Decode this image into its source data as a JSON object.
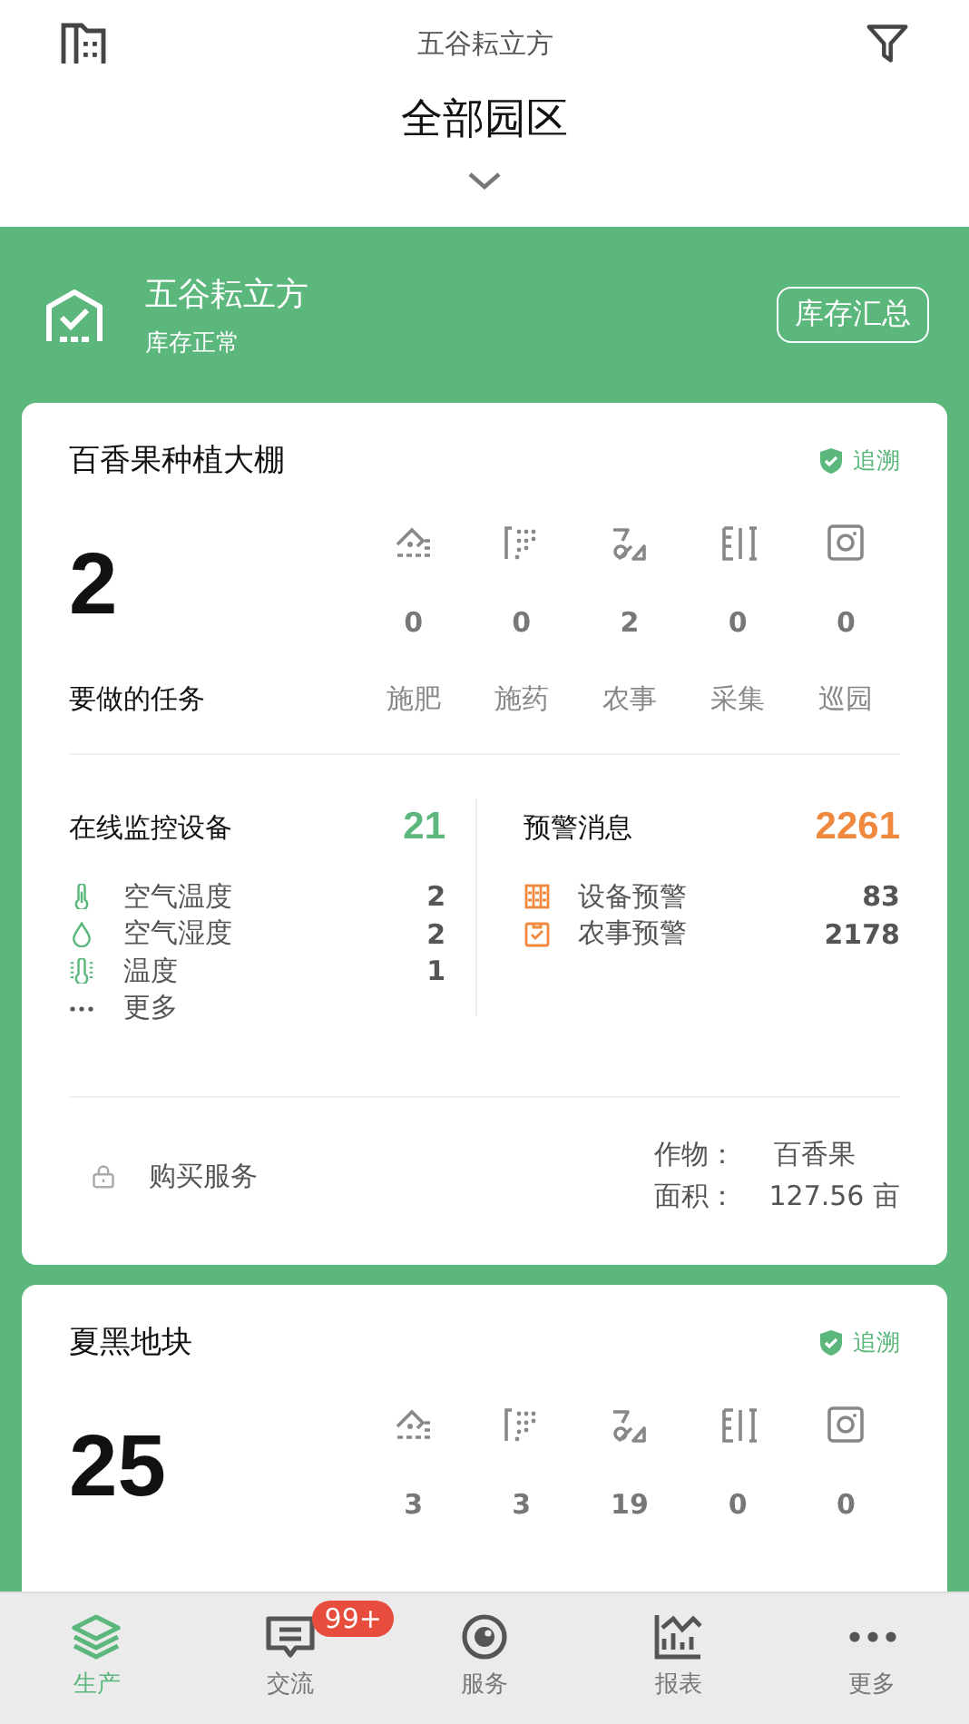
{
  "header": {
    "org": "五谷耘立方",
    "title": "全部园区"
  },
  "farm": {
    "name": "五谷耘立方",
    "status": "库存正常",
    "button": "库存汇总"
  },
  "cards": [
    {
      "title": "百香果种植大棚",
      "trace": "追溯",
      "tasks": {
        "count": "2",
        "label": "要做的任务"
      },
      "task_types": [
        {
          "kind": "fertilize",
          "count": "0",
          "label": "施肥"
        },
        {
          "kind": "spray",
          "count": "0",
          "label": "施药"
        },
        {
          "kind": "farm",
          "count": "2",
          "label": "农事"
        },
        {
          "kind": "harvest",
          "count": "0",
          "label": "采集"
        },
        {
          "kind": "patrol",
          "count": "0",
          "label": "巡园"
        }
      ],
      "monitoring": {
        "title": "在线监控设备",
        "count": "21",
        "items": [
          {
            "kind": "thermometer",
            "label": "空气温度",
            "count": "2"
          },
          {
            "kind": "drop",
            "label": "空气湿度",
            "count": "2"
          },
          {
            "kind": "heat",
            "label": "温度",
            "count": "1"
          },
          {
            "kind": "more",
            "label": "更多"
          }
        ]
      },
      "warnings": {
        "title": "预警消息",
        "count": "2261",
        "items": [
          {
            "kind": "device",
            "label": "设备预警",
            "count": "83"
          },
          {
            "kind": "farm",
            "label": "农事预警",
            "count": "2178"
          }
        ]
      },
      "service": "购买服务",
      "crop": {
        "crop_label": "作物：",
        "crop": "百香果",
        "area_label": "面积：",
        "area": "127.56 亩"
      }
    },
    {
      "title": "夏黑地块",
      "trace": "追溯",
      "tasks": {
        "count": "25"
      },
      "task_types": [
        {
          "kind": "fertilize",
          "count": "3"
        },
        {
          "kind": "spray",
          "count": "3"
        },
        {
          "kind": "farm",
          "count": "19"
        },
        {
          "kind": "harvest",
          "count": "0"
        },
        {
          "kind": "patrol",
          "count": "0"
        }
      ]
    }
  ],
  "tabs": [
    {
      "kind": "layers",
      "label": "生产",
      "selected": true
    },
    {
      "kind": "chat",
      "label": "交流",
      "selected": false,
      "badge": "99+"
    },
    {
      "kind": "eye",
      "label": "服务",
      "selected": false
    },
    {
      "kind": "chart",
      "label": "报表",
      "selected": false
    },
    {
      "kind": "dots",
      "label": "更多",
      "selected": false
    }
  ]
}
